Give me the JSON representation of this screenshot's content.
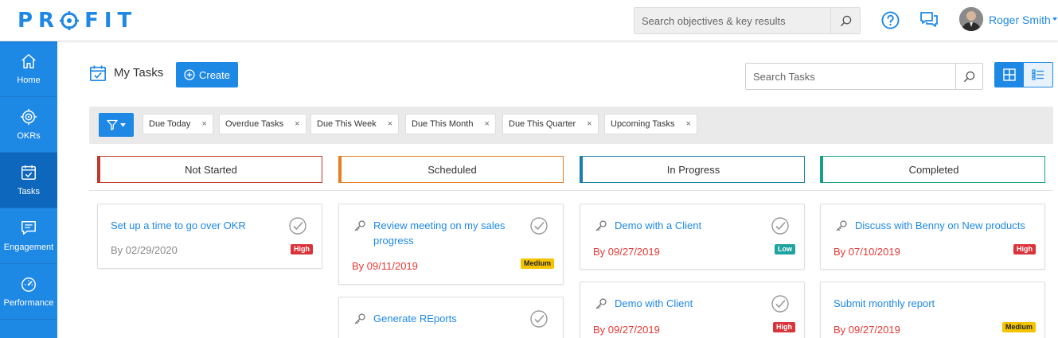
{
  "app": {
    "logo": "PR",
    "logo_tail": "FIT"
  },
  "header": {
    "search_placeholder": "Search objectives & key results",
    "user_name": "Roger Smith"
  },
  "sidebar": {
    "items": [
      {
        "label": "Home",
        "icon": "home-icon"
      },
      {
        "label": "OKRs",
        "icon": "target-icon"
      },
      {
        "label": "Tasks",
        "icon": "tasks-icon",
        "active": true
      },
      {
        "label": "Engagement",
        "icon": "message-icon"
      },
      {
        "label": "Performance",
        "icon": "gauge-icon"
      }
    ]
  },
  "page": {
    "title": "My Tasks",
    "create_label": "Create",
    "task_search_placeholder": "Search Tasks"
  },
  "filters": [
    {
      "label": "Due Today",
      "remove": "×"
    },
    {
      "label": "Overdue Tasks",
      "remove": "×"
    },
    {
      "label": "Due This Week",
      "remove": "×"
    },
    {
      "label": "Due This Month",
      "remove": "×"
    },
    {
      "label": "Due This Quarter",
      "remove": "×"
    },
    {
      "label": "Upcoming Tasks",
      "remove": "×"
    }
  ],
  "columns": [
    {
      "label": "Not Started",
      "color": "#c0392b"
    },
    {
      "label": "Scheduled",
      "color": "#e67e22"
    },
    {
      "label": "In Progress",
      "color": "#1a7fa6"
    },
    {
      "label": "Completed",
      "color": "#17a085"
    }
  ],
  "cards": {
    "not_started": [
      {
        "title": "Set up a time to go over OKR",
        "date": "By 02/29/2020",
        "priority": "High"
      }
    ],
    "scheduled": [
      {
        "title": "Review meeting on my sales progress",
        "date": "By 09/11/2019",
        "priority": "Medium"
      },
      {
        "title": "Generate REports"
      }
    ],
    "in_progress": [
      {
        "title": "Demo with a Client",
        "date": "By 09/27/2019",
        "priority": "Low"
      },
      {
        "title": "Demo with Client",
        "date": "By 09/27/2019",
        "priority": "High"
      }
    ],
    "completed": [
      {
        "title": "Discuss with Benny on New products",
        "date": "By 07/10/2019",
        "priority": "High"
      },
      {
        "title": "Submit monthly report",
        "date": "By 09/27/2019",
        "priority": "Medium"
      }
    ]
  },
  "colors": {
    "accent": "#1e88e5",
    "sidebar_active": "#0d67bd",
    "overdue": "#e53935"
  }
}
